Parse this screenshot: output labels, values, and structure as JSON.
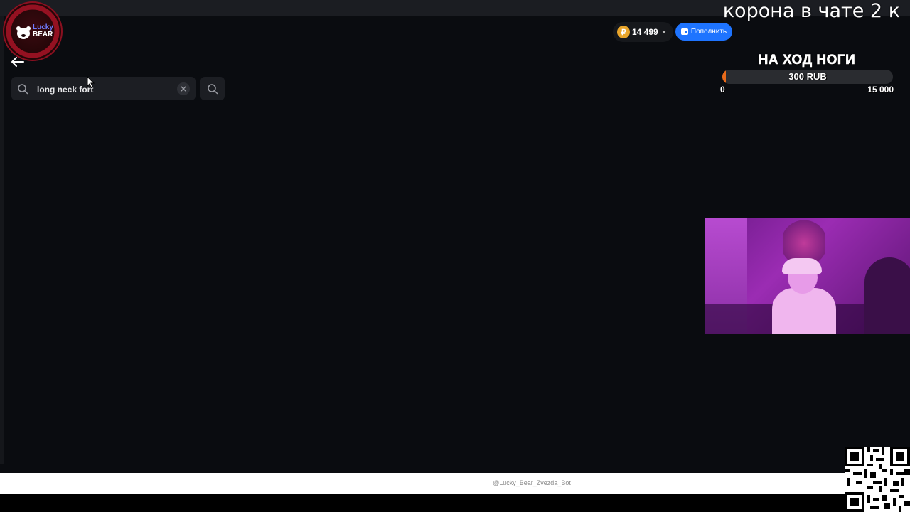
{
  "overlay": {
    "stream_text": "корона в чате 2 к"
  },
  "logo": {
    "line1": "Lucky",
    "line2": "BEAR"
  },
  "search": {
    "value": "long neck fort",
    "placeholder": ""
  },
  "header": {
    "balance": "14 499",
    "currency_symbol": "₽",
    "topup_label": "Пополнить"
  },
  "goal": {
    "title": "НА ХОД НОГИ",
    "amount_label": "300 RUB",
    "min_label": "0",
    "max_label": "15 000",
    "progress_fraction": 0.02
  },
  "footer": {
    "bot_handle": "@Lucky_Bear_Zvezda_Bot"
  },
  "colors": {
    "accent_blue": "#1e74ff",
    "coin_orange": "#e9a52a",
    "goal_fill": "#e86a1a",
    "background": "#0a0c10"
  },
  "icons": [
    "back-arrow-icon",
    "search-icon",
    "clear-icon",
    "coin-icon",
    "wallet-icon",
    "chevron-down-icon",
    "qr-code-icon",
    "cursor-pointer-icon"
  ]
}
